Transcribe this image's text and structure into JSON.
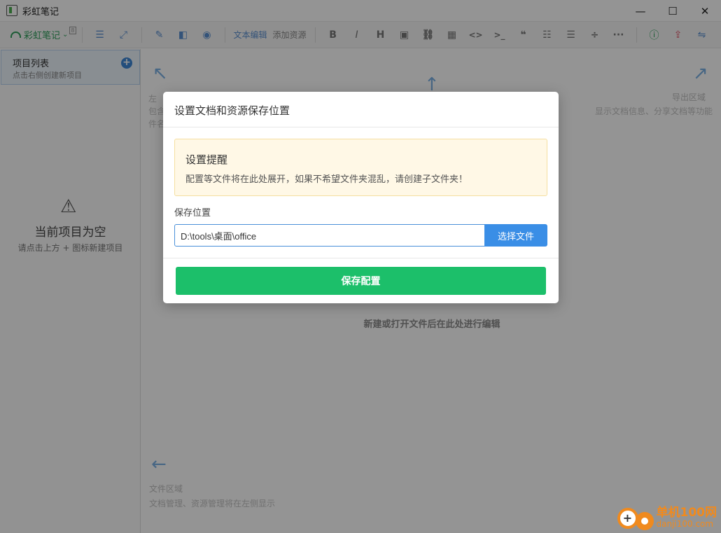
{
  "window": {
    "title": "彩虹笔记",
    "minimize": "—",
    "maximize": "☐",
    "close": "✕"
  },
  "toolbar": {
    "brand": "彩虹笔记",
    "brand_badge": "8",
    "text_edit": "文本编辑",
    "add_resource": "添加资源",
    "icons": {
      "list": "☰",
      "expand": "⤢",
      "edit": "✎",
      "split": "◧",
      "preview": "◉",
      "bold": "B",
      "italic": "I",
      "heading": "H",
      "image": "▣",
      "link": "⛓",
      "table": "▦",
      "code": "<>",
      "terminal": ">_",
      "quote": "❝",
      "ordered_list": "☷",
      "unordered_list": "☰",
      "divider": "÷",
      "more": "···",
      "info": "ⓘ",
      "upload": "⇪",
      "share": "⇋"
    }
  },
  "sidebar": {
    "title": "项目列表",
    "subtitle": "点击右侧创建新项目",
    "add": "+",
    "empty_icon": "⚠",
    "empty_title": "当前项目为空",
    "empty_sub": "请点击上方 + 图标新建项目"
  },
  "main": {
    "hint_left_arrow": "↖",
    "hint_top_arrow": "↑",
    "hint_right_arrow": "↗",
    "hint_left_text": "左",
    "hint_left_text2": "包含",
    "hint_left_text3": "件名",
    "export_title": "导出区域",
    "export_text": "显示文档信息、分享文档等功能",
    "center": "新建或打开文件后在此处进行编辑",
    "file_arrow": "←",
    "file_title": "文件区域",
    "file_text": "文档管理、资源管理将在左侧显示"
  },
  "dialog": {
    "title": "设置文档和资源保存位置",
    "notice_title": "设置提醒",
    "notice_text": "配置等文件将在此处展开，如果不希望文件夹混乱，请创建子文件夹！",
    "path_label": "保存位置",
    "path_value": "D:\\tools\\桌面\\office",
    "choose_button": "选择文件",
    "save_button": "保存配置"
  },
  "watermark": {
    "line1": "单机100网",
    "line2": "danji100.com"
  }
}
